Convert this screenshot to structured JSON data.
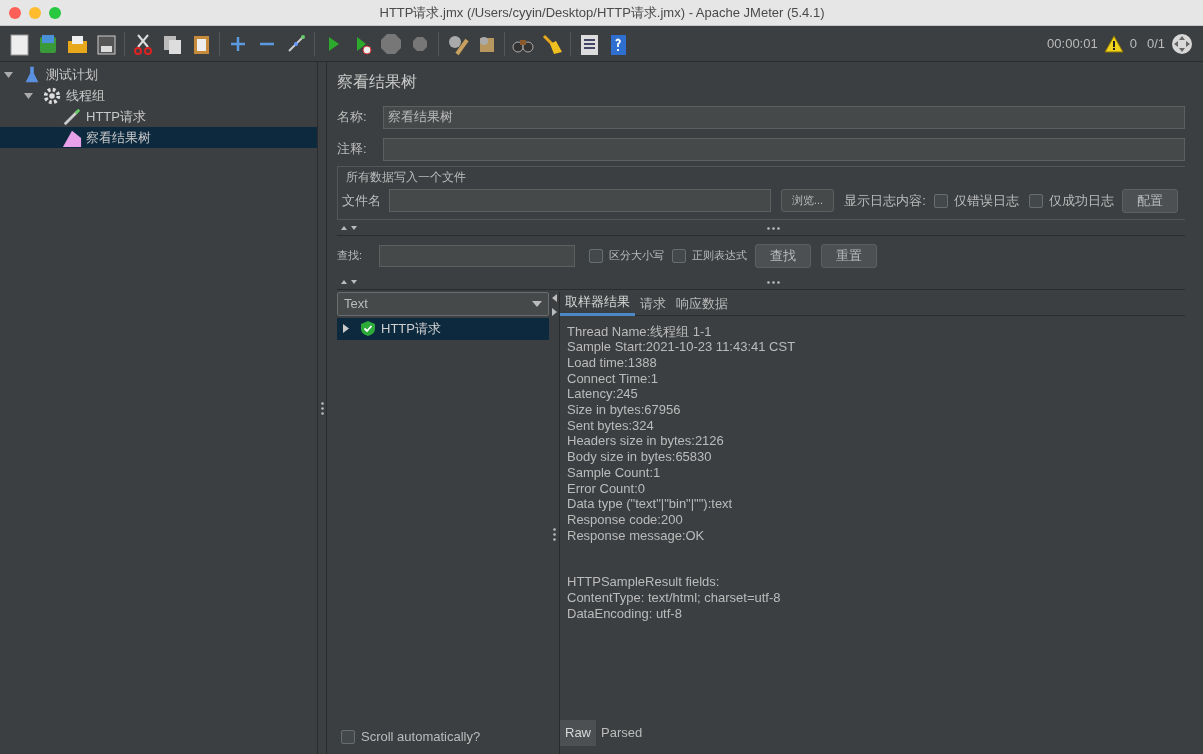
{
  "window": {
    "title": "HTTP请求.jmx (/Users/cyyin/Desktop/HTTP请求.jmx) - Apache JMeter (5.4.1)"
  },
  "toolbar": {
    "timer": "00:00:01",
    "warning_count": "0",
    "threads": "0/1"
  },
  "tree": [
    {
      "label": "测试计划",
      "kind": "plan",
      "expanded": true,
      "selected": false,
      "children": [
        {
          "label": "线程组",
          "kind": "thread-group",
          "expanded": true,
          "selected": false,
          "children": [
            {
              "label": "HTTP请求",
              "kind": "sampler",
              "selected": false
            },
            {
              "label": "察看结果树",
              "kind": "listener",
              "selected": true
            }
          ]
        }
      ]
    }
  ],
  "panel": {
    "title": "察看结果树",
    "name_label": "名称:",
    "name_value": "察看结果树",
    "comment_label": "注释:",
    "file_section": "所有数据写入一个文件",
    "file_label": "文件名",
    "browse_button": "浏览...",
    "log_label": "显示日志内容:",
    "log_options": [
      {
        "label": "仅错误日志",
        "checked": false
      },
      {
        "label": "仅成功日志",
        "checked": false
      }
    ],
    "config_button": "配置",
    "search_label": "查找:",
    "search_options": [
      {
        "label": "区分大小写",
        "checked": false
      },
      {
        "label": "正则表达式",
        "checked": false
      }
    ],
    "find_button": "查找",
    "reset_button": "重置"
  },
  "results": {
    "renderer": "Text",
    "items": [
      {
        "label": "HTTP请求",
        "success": true,
        "expanded": false,
        "selected": true
      }
    ],
    "scroll_auto": {
      "label": "Scroll automatically?",
      "checked": false
    },
    "tabs": [
      {
        "label": "取样器结果",
        "selected": true
      },
      {
        "label": "请求",
        "selected": false
      },
      {
        "label": "响应数据",
        "selected": false
      }
    ],
    "summary_lines": [
      "Thread Name:线程组 1-1",
      "Sample Start:2021-10-23 11:43:41 CST",
      "Load time:1388",
      "Connect Time:1",
      "Latency:245",
      "Size in bytes:67956",
      "Sent bytes:324",
      "Headers size in bytes:2126",
      "Body size in bytes:65830",
      "Sample Count:1",
      "Error Count:0",
      "Data type (\"text\"|\"bin\"|\"\"):text",
      "Response code:200",
      "Response message:OK"
    ],
    "field_lines": [
      "HTTPSampleResult fields:",
      "ContentType: text/html; charset=utf-8",
      "DataEncoding: utf-8"
    ],
    "bottom_tabs": [
      {
        "label": "Raw",
        "selected": true
      },
      {
        "label": "Parsed",
        "selected": false
      }
    ]
  }
}
